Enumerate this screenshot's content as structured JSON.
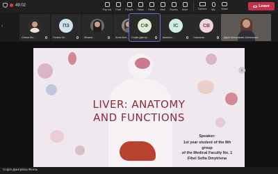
{
  "header": {
    "timer": "49:02",
    "tools": [
      {
        "label": "Pop out",
        "icon": "pop-out-icon"
      },
      {
        "label": "Chat",
        "icon": "chat-icon"
      },
      {
        "label": "People",
        "icon": "people-icon"
      },
      {
        "label": "Raise",
        "icon": "raise-hand-icon"
      },
      {
        "label": "React",
        "icon": "react-icon"
      },
      {
        "label": "View",
        "icon": "view-icon"
      },
      {
        "label": "Rooms",
        "icon": "rooms-icon"
      },
      {
        "label": "More",
        "icon": "more-icon"
      }
    ],
    "camera_label": "Camera",
    "mic_label": "Mic",
    "share_label": "Share",
    "leave_label": "Leave"
  },
  "participants": [
    {
      "name": "Олена Мо...",
      "type": "photo",
      "hair": "#3a2a22",
      "torso": "#e8e4e0",
      "bg": "#2e2e2e"
    },
    {
      "name": "Поліна Ое...",
      "type": "initials",
      "initials": "ПЗ",
      "color": "#cfe3ee",
      "text_color": "#3a4a5a"
    },
    {
      "name": "Мілана ...",
      "type": "photo",
      "hair": "#2a1c16",
      "torso": "#1e1e1e",
      "bg": "#6a6a6a"
    },
    {
      "name": "Алла Бол...",
      "type": "photo",
      "hair": "#4a3428",
      "torso": "#6a6a6a",
      "bg": "#8d8784"
    },
    {
      "name": "Софія Дмитрі...",
      "type": "initials",
      "initials": "СФ",
      "color": "#ddeed6",
      "text_color": "#3e5a36",
      "active": true
    },
    {
      "name": "Іванісен...",
      "type": "initials",
      "initials": "ІС",
      "color": "#d2ece6",
      "text_color": "#3a5a52"
    },
    {
      "name": "Смаліков...",
      "type": "initials",
      "initials": "СВ",
      "color": "#f0d4dc",
      "text_color": "#7a3a4a"
    }
  ],
  "self_view": {
    "name": "Дарія Максимова Смілянська"
  },
  "slide": {
    "title": "LIVER: ANATOMY\nAND FUNCTIONS",
    "speaker_label": "Speaker:",
    "speaker": "1st year student of the 8th\ngroup\nof the Medical Faculty No. 1\nFihel Sofia Dmytrivna"
  },
  "presenter_label": "Софія Дмитрівна Фігель"
}
